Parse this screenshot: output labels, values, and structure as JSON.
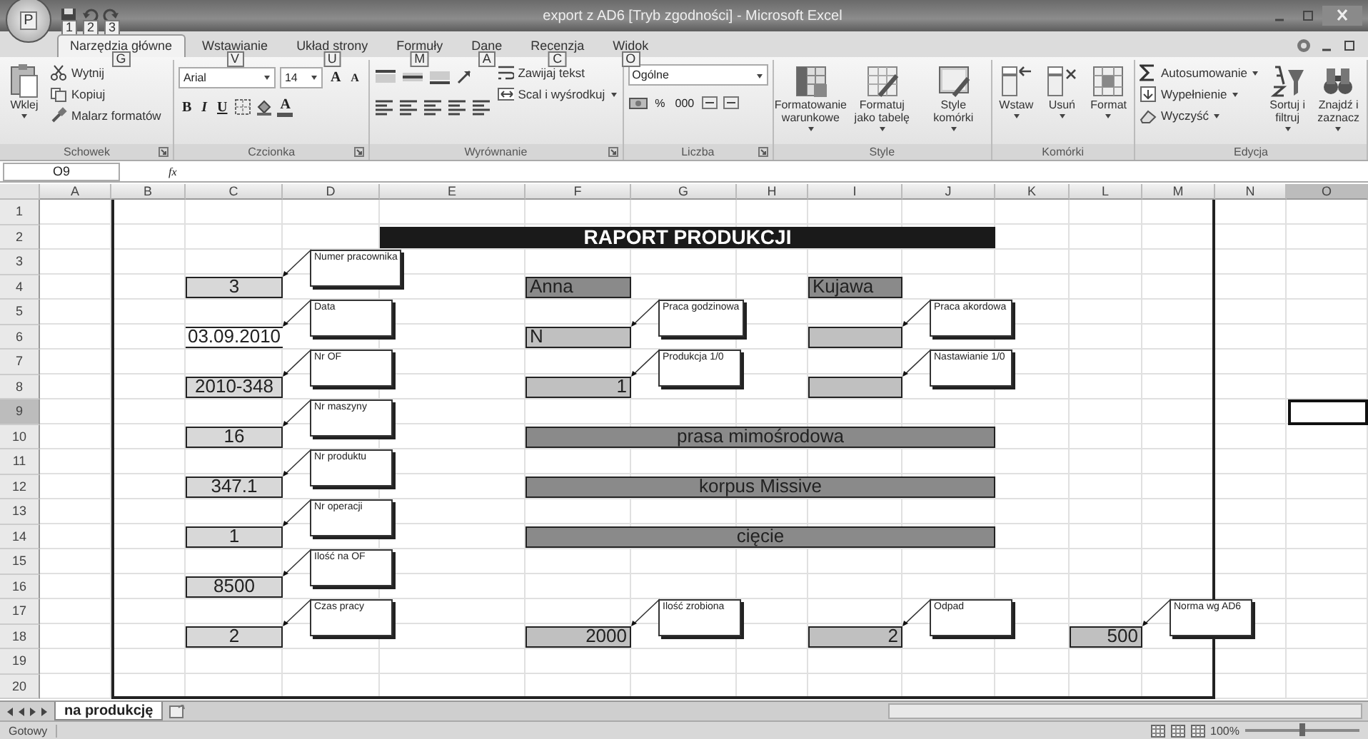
{
  "window": {
    "title": "export z AD6  [Tryb zgodności] - Microsoft Excel",
    "office_keytip": "P",
    "quick_access_keytips": [
      "1",
      "2",
      "3"
    ]
  },
  "ribbon": {
    "tabs": [
      {
        "label": "Narzędzia główne",
        "keytip": "G",
        "selected": true
      },
      {
        "label": "Wstawianie",
        "keytip": "V",
        "selected": false
      },
      {
        "label": "Układ strony",
        "keytip": "U",
        "selected": false
      },
      {
        "label": "Formuły",
        "keytip": "M",
        "selected": false
      },
      {
        "label": "Dane",
        "keytip": "A",
        "selected": false
      },
      {
        "label": "Recenzja",
        "keytip": "C",
        "selected": false
      },
      {
        "label": "Widok",
        "keytip": "O",
        "selected": false
      }
    ],
    "groups": [
      {
        "kind": "clipboard",
        "label": "Schowek",
        "launcher": true,
        "big": {
          "label": "Wklej"
        },
        "small": [
          "Wytnij",
          "Kopiuj",
          "Malarz formatów"
        ]
      },
      {
        "kind": "font",
        "label": "Czcionka",
        "launcher": true,
        "font": "Arial",
        "size": "14",
        "grow": "A",
        "shrink": "A",
        "bold": "B",
        "italic": "I",
        "underline": "U",
        "font_color": "A"
      },
      {
        "kind": "alignment",
        "label": "Wyrównanie",
        "launcher": true,
        "small": [
          "Zawijaj tekst",
          "Scal i wyśrodkuj"
        ]
      },
      {
        "kind": "number",
        "label": "Liczba",
        "launcher": true,
        "format": "Ogólne",
        "percent": "%",
        "thousands": "000"
      },
      {
        "kind": "styles",
        "label": "Style",
        "launcher": false,
        "big": [
          "Formatowanie warunkowe",
          "Formatuj jako tabelę",
          "Style komórki"
        ]
      },
      {
        "kind": "cells",
        "label": "Komórki",
        "launcher": false,
        "big": [
          "Wstaw",
          "Usuń",
          "Format"
        ]
      },
      {
        "kind": "editing",
        "label": "Edycja",
        "launcher": false,
        "small": [
          "Autosumowanie",
          "Wypełnienie",
          "Wyczyść"
        ],
        "big": [
          "Sortuj i filtruj",
          "Znajdź i zaznacz"
        ]
      }
    ]
  },
  "formula_bar": {
    "name_box": "O9",
    "fx": "fx"
  },
  "sheet": {
    "columns": [
      {
        "label": "A",
        "selected": false
      },
      {
        "label": "B",
        "selected": false
      },
      {
        "label": "C",
        "selected": false
      },
      {
        "label": "D",
        "selected": false
      },
      {
        "label": "E",
        "selected": false
      },
      {
        "label": "F",
        "selected": false
      },
      {
        "label": "G",
        "selected": false
      },
      {
        "label": "H",
        "selected": false
      },
      {
        "label": "I",
        "selected": false
      },
      {
        "label": "J",
        "selected": false
      },
      {
        "label": "K",
        "selected": false
      },
      {
        "label": "L",
        "selected": false
      },
      {
        "label": "M",
        "selected": false
      },
      {
        "label": "N",
        "selected": false
      },
      {
        "label": "O",
        "selected": true
      }
    ],
    "row_headers": [
      {
        "number": "1",
        "selected": false
      },
      {
        "number": "2",
        "selected": false
      },
      {
        "number": "3",
        "selected": false
      },
      {
        "number": "4",
        "selected": false
      },
      {
        "number": "5",
        "selected": false
      },
      {
        "number": "6",
        "selected": false
      },
      {
        "number": "7",
        "selected": false
      },
      {
        "number": "8",
        "selected": false
      },
      {
        "number": "9",
        "selected": true
      },
      {
        "number": "10",
        "selected": false
      },
      {
        "number": "11",
        "selected": false
      },
      {
        "number": "12",
        "selected": false
      },
      {
        "number": "13",
        "selected": false
      },
      {
        "number": "14",
        "selected": false
      },
      {
        "number": "15",
        "selected": false
      },
      {
        "number": "16",
        "selected": false
      },
      {
        "number": "17",
        "selected": false
      },
      {
        "number": "18",
        "selected": false
      },
      {
        "number": "19",
        "selected": false
      },
      {
        "number": "20",
        "selected": false
      }
    ],
    "report": {
      "title": "RAPORT PRODUKCJI",
      "left_fields": [
        {
          "value": "3",
          "kind": "filled",
          "comment": "Numer pracownika"
        },
        {
          "value": "03.09.2010",
          "kind": "lined",
          "comment": "Data"
        },
        {
          "value": "2010-348",
          "kind": "filled",
          "comment": "Nr OF"
        },
        {
          "value": "16",
          "kind": "filled",
          "comment": "Nr maszyny"
        },
        {
          "value": "347.1",
          "kind": "filled",
          "comment": "Nr produktu"
        },
        {
          "value": "1",
          "kind": "filled",
          "comment": "Nr operacji"
        },
        {
          "value": "8500",
          "kind": "filled",
          "comment": "Ilość na OF"
        },
        {
          "value": "2",
          "kind": "filled",
          "comment": "Czas pracy"
        }
      ],
      "names": [
        "Anna",
        "Kujawa"
      ],
      "flags": [
        {
          "value": "N",
          "comment": "Praca godzinowa"
        },
        {
          "comment": "Praca akordowa"
        },
        {
          "value": "1",
          "comment": "Produkcja 1/0"
        },
        {
          "comment": "Nastawianie 1/0"
        }
      ],
      "descriptions": [
        "prasa mimośrodowa",
        "korpus Missive",
        "cięcie"
      ],
      "results": [
        {
          "value": "2000",
          "comment": "Ilość zrobiona"
        },
        {
          "value": "2",
          "comment": "Odpad"
        },
        {
          "value": "500",
          "comment": "Norma wg AD6"
        }
      ]
    }
  },
  "sheet_tabs": [
    {
      "label": "na produkcję",
      "selected": true
    }
  ],
  "status_bar": {
    "status": "Gotowy",
    "zoom": "100%",
    "zoom_slider": {
      "level": 0.5
    }
  }
}
